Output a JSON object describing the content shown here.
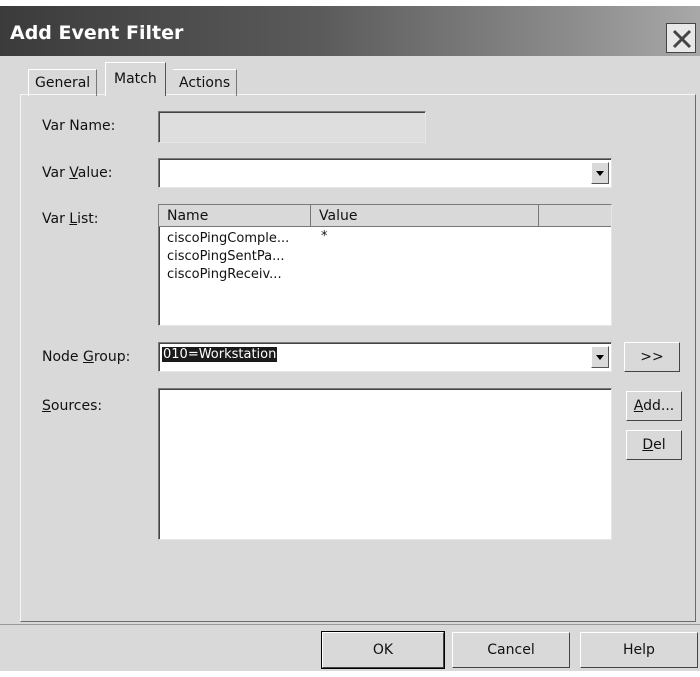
{
  "window": {
    "title": "Add Event Filter"
  },
  "tabs": [
    {
      "label": "General"
    },
    {
      "label": "Match"
    },
    {
      "label": "Actions"
    }
  ],
  "form": {
    "var_name": {
      "label": "Var Name:",
      "value": ""
    },
    "var_value": {
      "label_pre": "Var ",
      "label_key": "V",
      "label_post": "alue:",
      "value": ""
    },
    "var_list": {
      "label_pre": "Var ",
      "label_key": "L",
      "label_post": "ist:",
      "columns": [
        "Name",
        "Value"
      ],
      "rows": [
        {
          "name": "ciscoPingComple...",
          "value": "*"
        },
        {
          "name": "ciscoPingSentPa...",
          "value": ""
        },
        {
          "name": "ciscoPingReceiv...",
          "value": ""
        }
      ]
    },
    "node_group": {
      "label_pre": "Node ",
      "label_key": "G",
      "label_post": "roup:",
      "value": "010=Workstation",
      "more_button": ">>"
    },
    "sources": {
      "label_key": "S",
      "label_post": "ources:",
      "add_pre": "",
      "add_key": "A",
      "add_post": "dd...",
      "del_key": "D",
      "del_post": "el"
    }
  },
  "footer": {
    "ok": "OK",
    "cancel": "Cancel",
    "help": "Help"
  },
  "icons": [
    "close-icon",
    "dropdown-arrow-icon"
  ]
}
